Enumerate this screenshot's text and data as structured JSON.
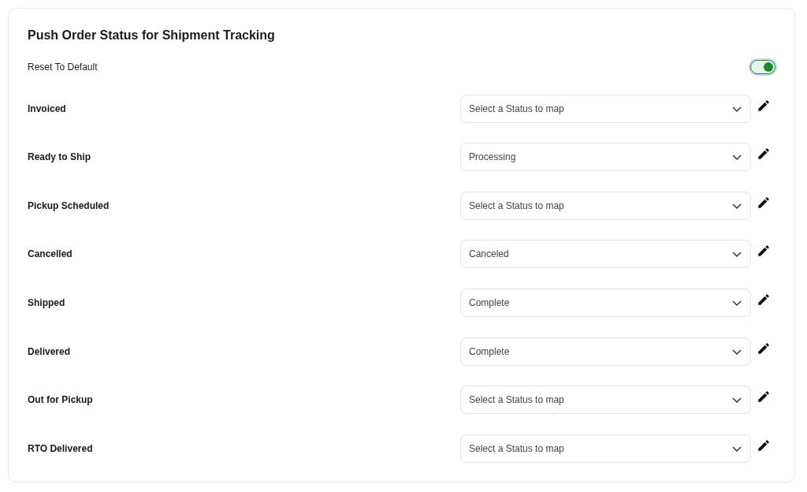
{
  "title": "Push Order Status for Shipment Tracking",
  "reset": {
    "label": "Reset To Default",
    "on": true
  },
  "mappings": [
    {
      "label": "Invoiced",
      "placeholder": "Select a Status to map"
    },
    {
      "label": "Ready to Ship",
      "value": "Processing"
    },
    {
      "label": "Pickup Scheduled",
      "placeholder": "Select a Status to map"
    },
    {
      "label": "Cancelled",
      "value": "Canceled"
    },
    {
      "label": "Shipped",
      "value": "Complete"
    },
    {
      "label": "Delivered",
      "value": "Complete"
    },
    {
      "label": "Out for Pickup",
      "placeholder": "Select a Status to map"
    },
    {
      "label": "RTO Delivered",
      "placeholder": "Select a Status to map"
    }
  ]
}
